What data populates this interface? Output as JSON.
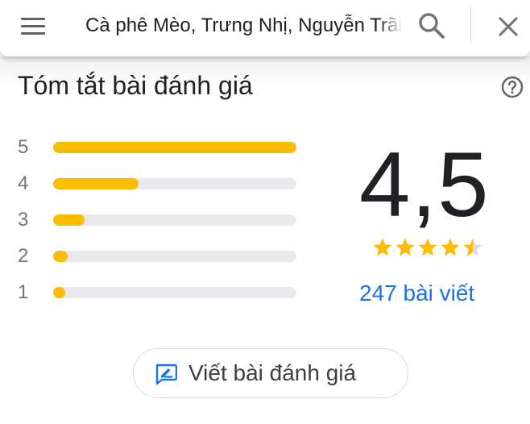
{
  "search": {
    "value": "Cà phê Mèo, Trưng Nhị, Nguyễn Trãi"
  },
  "summary": {
    "title": "Tóm tắt bài đánh giá"
  },
  "ratings": [
    {
      "label": "5",
      "fraction": 1.0
    },
    {
      "label": "4",
      "fraction": 0.35
    },
    {
      "label": "3",
      "fraction": 0.13
    },
    {
      "label": "2",
      "fraction": 0.06
    },
    {
      "label": "1",
      "fraction": 0.05
    }
  ],
  "score": {
    "value": "4,5",
    "stars": 4.5,
    "review_count": "247 bài viết"
  },
  "write_review": {
    "label": "Viết bài đánh giá"
  },
  "colors": {
    "star": "#fbbc04",
    "link": "#1a73e8",
    "track": "#e8eaed"
  },
  "icons": [
    "menu-icon",
    "search-icon",
    "close-icon",
    "help-icon",
    "write-review-icon",
    "star-icon"
  ]
}
